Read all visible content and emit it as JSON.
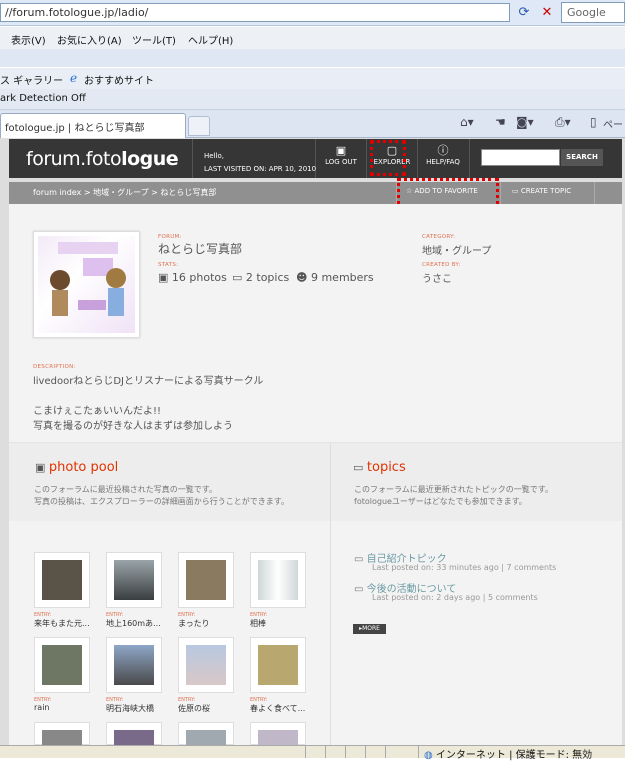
{
  "browser": {
    "address": "//forum.fotologue.jp/ladio/",
    "search_placeholder": "Google",
    "menu": [
      "表示(V)",
      "お気に入り(A)",
      "ツール(T)",
      "ヘルプ(H)"
    ],
    "favorites": [
      "ス ギャラリー",
      "おすすめサイト"
    ],
    "dnt_text": "ark Detection Off",
    "tab_title": "fotologue.jp | ねとらじ写真部",
    "page_menu": "ペー",
    "status": "インターネット | 保護モード: 無効"
  },
  "header": {
    "logo_plain": "forum.foto",
    "logo_bold": "logue",
    "hello": "Hello,",
    "last_visited": "LAST VISITED ON: APR 10, 2010",
    "nav": [
      {
        "label": "LOG OUT",
        "icon": "logout-icon"
      },
      {
        "label": "EXPLORER",
        "icon": "explorer-icon"
      },
      {
        "label": "HELP/FAQ",
        "icon": "help-icon"
      }
    ],
    "search_button": "SEARCH"
  },
  "breadcrumb": "forum index > 地域・グループ > ねとらじ写真部",
  "actions": {
    "add_favorite": "ADD TO FAVORITE",
    "create_topic": "CREATE TOPIC"
  },
  "forum": {
    "forum_label": "FORUM:",
    "name": "ねとらじ写真部",
    "stats_label": "STATS:",
    "photos": "16 photos",
    "topics": "2 topics",
    "members": "9 members",
    "category_label": "CATEGORY:",
    "category": "地域・グループ",
    "created_label": "CREATED BY:",
    "created_by": "うさこ",
    "description_label": "DESCRIPTION:",
    "description": [
      "livedoorねとらじDJとリスナーによる写真サークル",
      "",
      "こまけぇこたぁいいんだよ!!",
      "写真を撮るのが好きな人はまずは参加しよう"
    ]
  },
  "photo_pool": {
    "title": "photo pool",
    "desc": [
      "このフォーラムに最近投稿された写真の一覧です。",
      "写真の投稿は、エクスプローラーの詳細画面から行うことができます。"
    ],
    "entry_label": "ENTRY:",
    "entries": [
      "来年もまた元...",
      "地上160mあ...",
      "まったり",
      "相棒",
      "rain",
      "明石海峡大橋",
      "佐原の桜",
      "春よく食べて..."
    ]
  },
  "topics": {
    "title": "topics",
    "desc": [
      "このフォーラムに最近更新されたトピックの一覧です。",
      "fotologueユーザーはどなたでも参加できます。"
    ],
    "items": [
      {
        "title": "自己紹介トピック",
        "meta": "Last posted on: 33 minutes ago | 7 comments"
      },
      {
        "title": "今後の活動について",
        "meta": "Last posted on: 2 days ago | 5 comments"
      }
    ],
    "more": "MORE"
  }
}
